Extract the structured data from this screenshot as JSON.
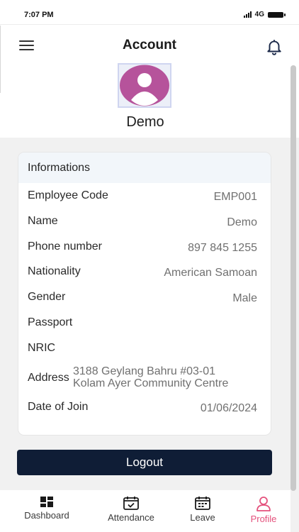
{
  "status_bar": {
    "time": "7:07 PM",
    "network": "4G"
  },
  "header": {
    "title": "Account"
  },
  "user": {
    "name": "Demo"
  },
  "info": {
    "heading": "Informations",
    "rows": [
      {
        "label": "Employee Code",
        "value": "EMP001"
      },
      {
        "label": "Name",
        "value": "Demo"
      },
      {
        "label": "Phone number",
        "value": "897 845 1255"
      },
      {
        "label": "Nationality",
        "value": "American Samoan"
      },
      {
        "label": "Gender",
        "value": "Male"
      },
      {
        "label": "Passport",
        "value": ""
      },
      {
        "label": "NRIC",
        "value": ""
      },
      {
        "label": "Address",
        "value_line1": "3188 Geylang Bahru #03-01",
        "value_line2": "Kolam Ayer Community Centre"
      },
      {
        "label": "Date of Join",
        "value": "01/06/2024"
      }
    ]
  },
  "logout_label": "Logout",
  "nav": {
    "items": [
      {
        "label": "Dashboard",
        "icon": "dashboard-icon"
      },
      {
        "label": "Attendance",
        "icon": "attendance-icon"
      },
      {
        "label": "Leave",
        "icon": "leave-icon"
      },
      {
        "label": "Profile",
        "icon": "profile-icon",
        "active": true
      }
    ]
  },
  "colors": {
    "primary_button": "#0f1d36",
    "active_tab": "#e4517c",
    "avatar": "#b6539b"
  }
}
